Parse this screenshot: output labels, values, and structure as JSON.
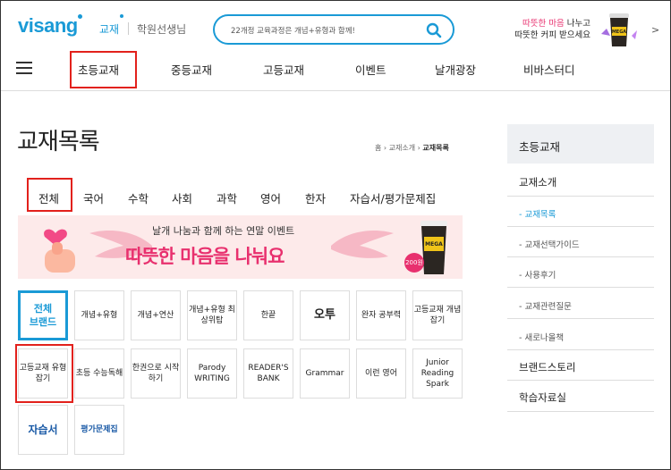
{
  "header": {
    "logo": "visang",
    "audience_label": "교재",
    "audience_alt": "학원선생님",
    "search_placeholder": "22개정 교육과정은 개념+유형과 함께!",
    "promo_line1_hl": "따뜻한 마음",
    "promo_line1_rest": " 나누고",
    "promo_line2": "따뜻한 커피 받으세요",
    "promo_next": ">"
  },
  "nav": {
    "items": [
      "초등교재",
      "중등교재",
      "고등교재",
      "이벤트",
      "날개광장",
      "비바스터디"
    ]
  },
  "page": {
    "title": "교재목록",
    "breadcrumb": [
      "홈",
      "교재소개",
      "교재목록"
    ]
  },
  "tabs": [
    "전체",
    "국어",
    "수학",
    "사회",
    "과학",
    "영어",
    "한자",
    "자습서/평가문제집"
  ],
  "banner": {
    "subtitle": "날개 나눔과 함께 하는 연말 이벤트",
    "title": "따뜻한 마음을 나눠요",
    "price": "200원"
  },
  "brands": [
    "전체\n브랜드",
    "개념+유형",
    "개념+연산",
    "개념+유형 최상위탑",
    "한끝",
    "오투",
    "완자 공부력",
    "고등교재 개념잡기",
    "고등교재 유형잡기",
    "초등 수능독해",
    "한권으로 시작하기",
    "Parody WRITING",
    "READER'S BANK",
    "Grammar",
    "이런 영어",
    "Junior Reading Spark",
    "자습서",
    "평가문제집"
  ],
  "sidebar": {
    "header": "초등교재",
    "items": [
      {
        "label": "교재소개"
      },
      {
        "label": "- 교재목록",
        "active": true
      },
      {
        "label": "- 교재선택가이드"
      },
      {
        "label": "- 사용후기"
      },
      {
        "label": "- 교재관련질문"
      },
      {
        "label": "- 새로나올책"
      },
      {
        "label": "브랜드스토리"
      },
      {
        "label": "학습자료실"
      }
    ]
  },
  "colors": {
    "accent": "#1a9ad6",
    "highlight": "#e2211c",
    "pink": "#e8306e"
  }
}
